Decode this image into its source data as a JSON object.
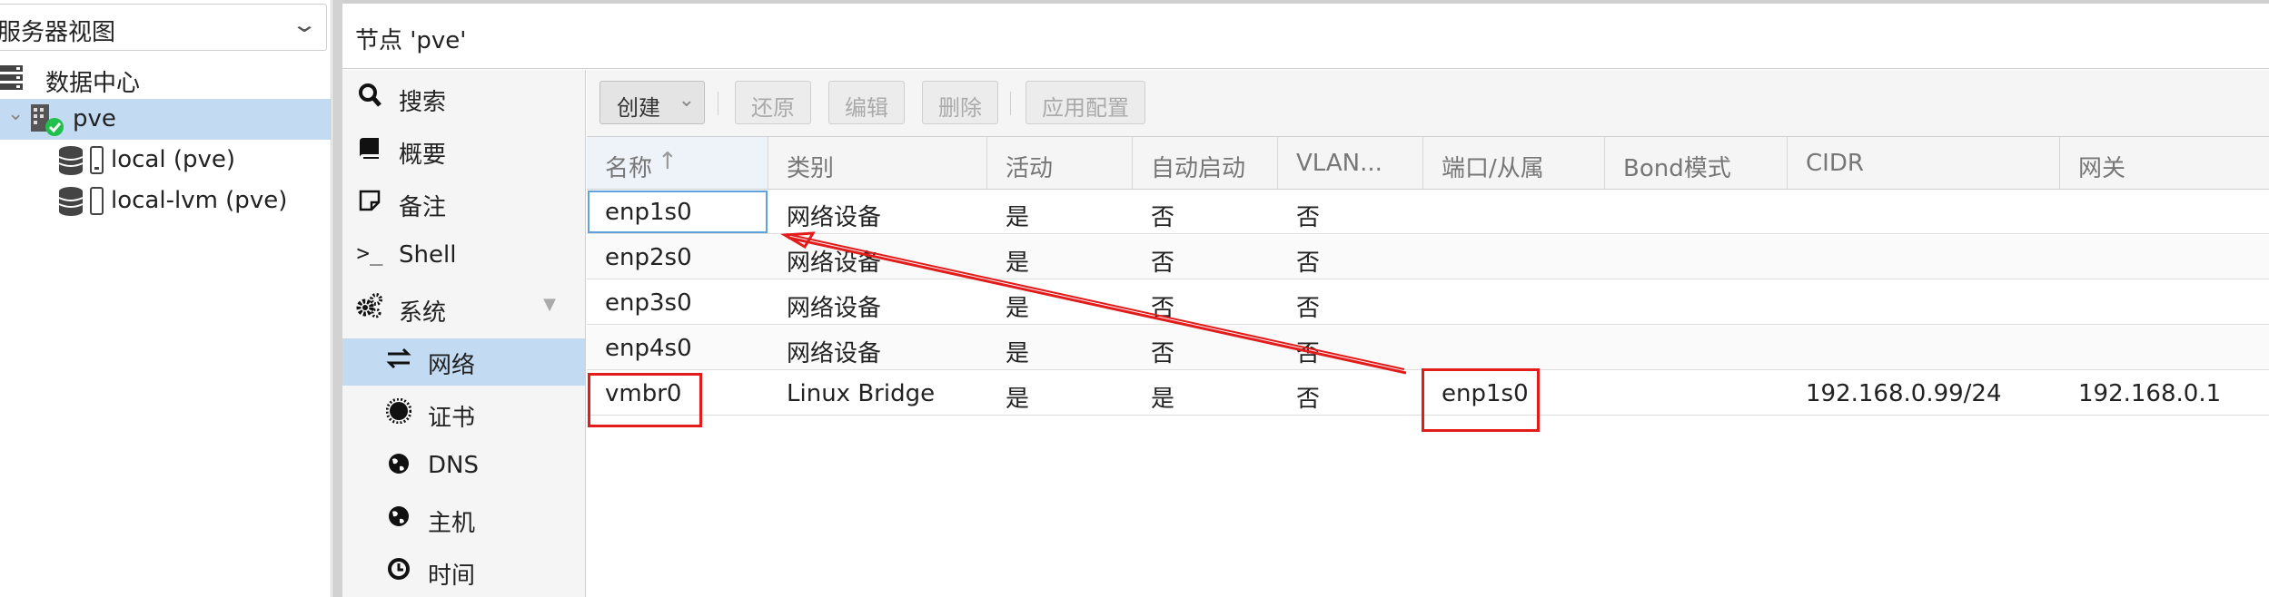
{
  "tree": {
    "view_label": "服务器视图",
    "items": [
      {
        "label": "数据中心"
      },
      {
        "label": "pve"
      },
      {
        "label": "local (pve)"
      },
      {
        "label": "local-lvm (pve)"
      }
    ]
  },
  "header": {
    "title": "节点 'pve'"
  },
  "nav": {
    "items": [
      {
        "label": "搜索",
        "icon": "search-icon"
      },
      {
        "label": "概要",
        "icon": "book-icon"
      },
      {
        "label": "备注",
        "icon": "note-icon"
      },
      {
        "label": "Shell",
        "icon": "terminal-icon"
      },
      {
        "label": "系统",
        "icon": "gears-icon"
      },
      {
        "label": "网络",
        "icon": "exchange-icon"
      },
      {
        "label": "证书",
        "icon": "certificate-icon"
      },
      {
        "label": "DNS",
        "icon": "globe-icon"
      },
      {
        "label": "主机",
        "icon": "globe-icon"
      },
      {
        "label": "时间",
        "icon": "clock-icon"
      }
    ]
  },
  "toolbar": {
    "create": "创建",
    "revert": "还原",
    "edit": "编辑",
    "delete": "删除",
    "apply": "应用配置"
  },
  "grid": {
    "columns": [
      "名称",
      "类别",
      "活动",
      "自动启动",
      "VLAN...",
      "端口/从属",
      "Bond模式",
      "CIDR",
      "网关"
    ],
    "sort_indicator": "↑",
    "rows": [
      {
        "name": "enp1s0",
        "type": "网络设备",
        "active": "是",
        "autostart": "否",
        "vlan": "否",
        "ports": "",
        "bond": "",
        "cidr": "",
        "gateway": ""
      },
      {
        "name": "enp2s0",
        "type": "网络设备",
        "active": "是",
        "autostart": "否",
        "vlan": "否",
        "ports": "",
        "bond": "",
        "cidr": "",
        "gateway": ""
      },
      {
        "name": "enp3s0",
        "type": "网络设备",
        "active": "是",
        "autostart": "否",
        "vlan": "否",
        "ports": "",
        "bond": "",
        "cidr": "",
        "gateway": ""
      },
      {
        "name": "enp4s0",
        "type": "网络设备",
        "active": "是",
        "autostart": "否",
        "vlan": "否",
        "ports": "",
        "bond": "",
        "cidr": "",
        "gateway": ""
      },
      {
        "name": "vmbr0",
        "type": "Linux Bridge",
        "active": "是",
        "autostart": "是",
        "vlan": "否",
        "ports": "enp1s0",
        "bond": "",
        "cidr": "192.168.0.99/24",
        "gateway": "192.168.0.1"
      }
    ]
  },
  "colors": {
    "selection": "#c3dbf2",
    "annotation": "#e31b1b",
    "focus": "#5fa2dd"
  }
}
